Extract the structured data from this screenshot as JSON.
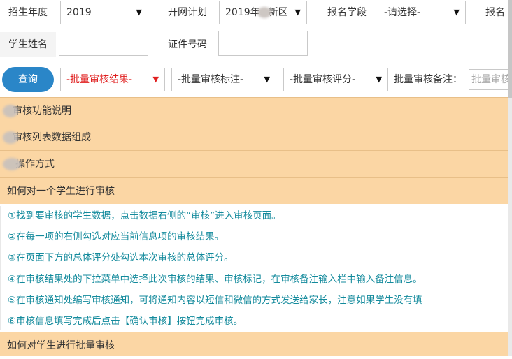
{
  "filters": {
    "enroll_year": {
      "label": "招生年度",
      "value": "2019"
    },
    "plan": {
      "label": "开网计划",
      "value": "2019年",
      "value_suffix": "新区"
    },
    "stage": {
      "label": "报名学段",
      "value": "-请选择-"
    },
    "partial_label": "报名"
  },
  "student": {
    "name_label": "学生姓名",
    "id_label": "证件号码"
  },
  "batch": {
    "query_button": "查询",
    "result_select": "-批量审核结果-",
    "mark_select": "-批量审核标注-",
    "score_select": "-批量审核评分-",
    "note_label": "批量审核备注：",
    "note_placeholder": "批量审核"
  },
  "help": {
    "sections": [
      {
        "title": "审核功能说明"
      },
      {
        "title": "审核列表数据组成"
      },
      {
        "title": "操作方式"
      },
      {
        "title": "如何对一个学生进行审核"
      }
    ],
    "steps": [
      "①找到要审核的学生数据，点击数据右侧的“审核”进入审核页面。",
      "②在每一项的右侧勾选对应当前信息项的审核结果。",
      "③在页面下方的总体评分处勾选本次审核的总体评分。",
      "④在审核结果处的下拉菜单中选择此次审核的结果、审核标记，在审核备注输入栏中输入备注信息。",
      "⑤在审核通知处编写审核通知，可将通知内容以短信和微信的方式发送给家长，注意如果学生没有填",
      "⑥审核信息填写完成后点击【确认审核】按钮完成审核。"
    ],
    "last_section": "如何对学生进行批量审核"
  },
  "colors": {
    "accordion_bg": "#fbd6a4",
    "step_text": "#138a9c",
    "query_button": "#2a86c8",
    "red_select": "#e02020"
  },
  "icons": {
    "dropdown": "triangle-down-icon"
  }
}
